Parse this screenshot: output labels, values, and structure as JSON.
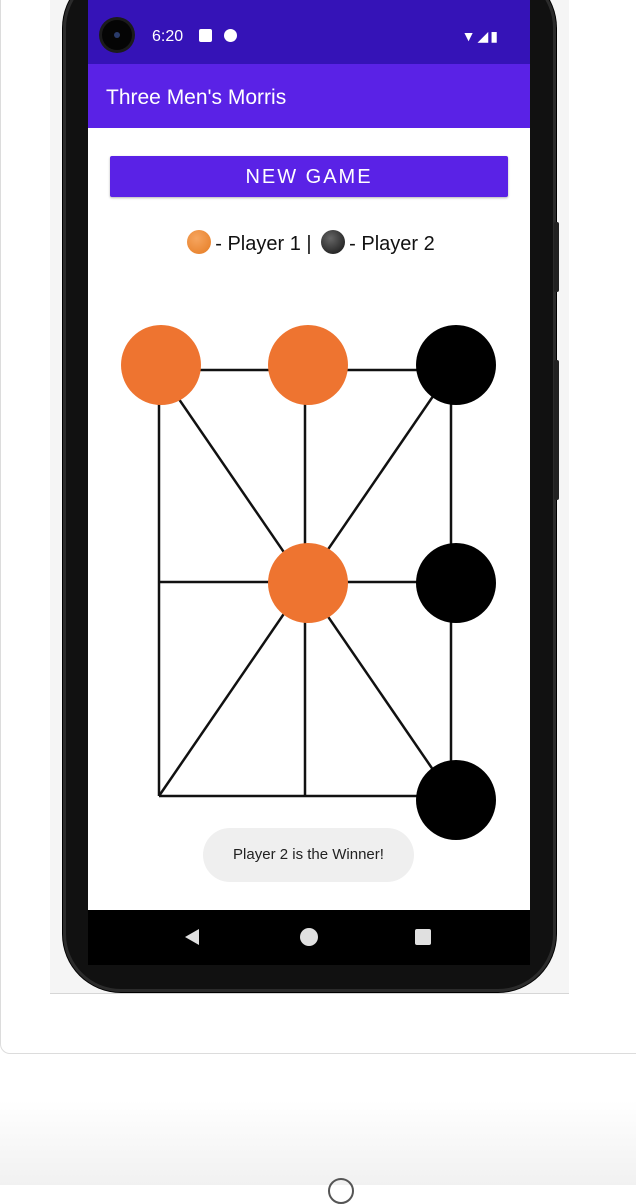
{
  "status_bar": {
    "time": "6:20",
    "right_icons": "▼◢▮"
  },
  "app": {
    "title": "Three Men's Morris"
  },
  "controls": {
    "new_game_label": "NEW GAME"
  },
  "legend": {
    "player1": "- Player 1 |",
    "player2": "- Player 2"
  },
  "colors": {
    "player1": "#ee7430",
    "player2": "#000000",
    "accent": "#5a22e6",
    "status": "#3513b7"
  },
  "board": {
    "cells": [
      [
        "orange",
        "orange",
        "black"
      ],
      [
        "empty",
        "orange",
        "black"
      ],
      [
        "empty",
        "empty",
        "black"
      ]
    ]
  },
  "toast": {
    "message": "Player 2 is the Winner!"
  }
}
